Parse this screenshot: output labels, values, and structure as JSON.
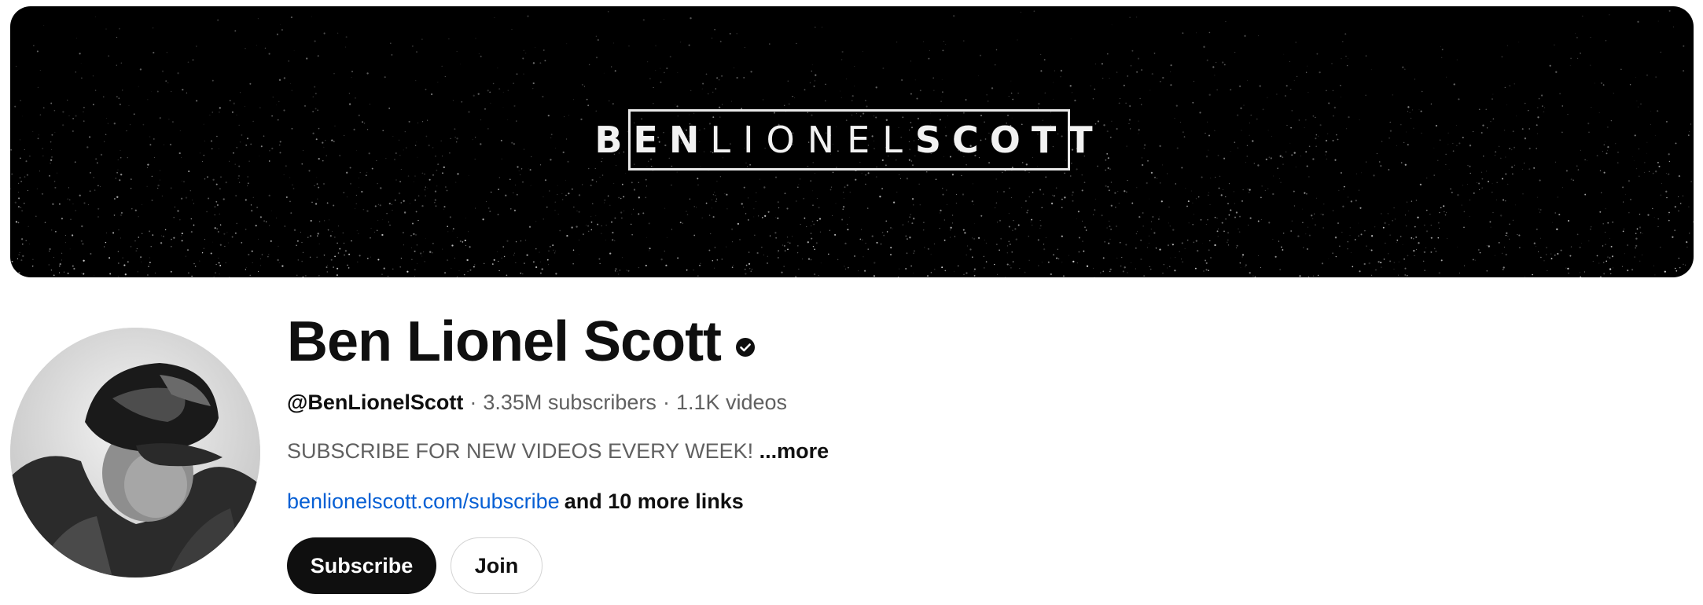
{
  "banner": {
    "logo_part1": "BEN",
    "logo_part2": "LIONEL",
    "logo_part3": "SCOTT"
  },
  "channel": {
    "name": "Ben Lionel Scott",
    "verified_icon": "verified-check-icon",
    "handle": "@BenLionelScott",
    "separator": "·",
    "subscribers": "3.35M subscribers",
    "videos": "1.1K videos",
    "description": "SUBSCRIBE FOR NEW VIDEOS EVERY WEEK!",
    "more_label": "...more",
    "link_text": "benlionelscott.com/subscribe",
    "more_links": "and 10 more links"
  },
  "actions": {
    "subscribe_label": "Subscribe",
    "join_label": "Join"
  },
  "colors": {
    "link": "#065fd4",
    "subscribe_bg": "#0f0f0f",
    "secondary_text": "#606060"
  }
}
